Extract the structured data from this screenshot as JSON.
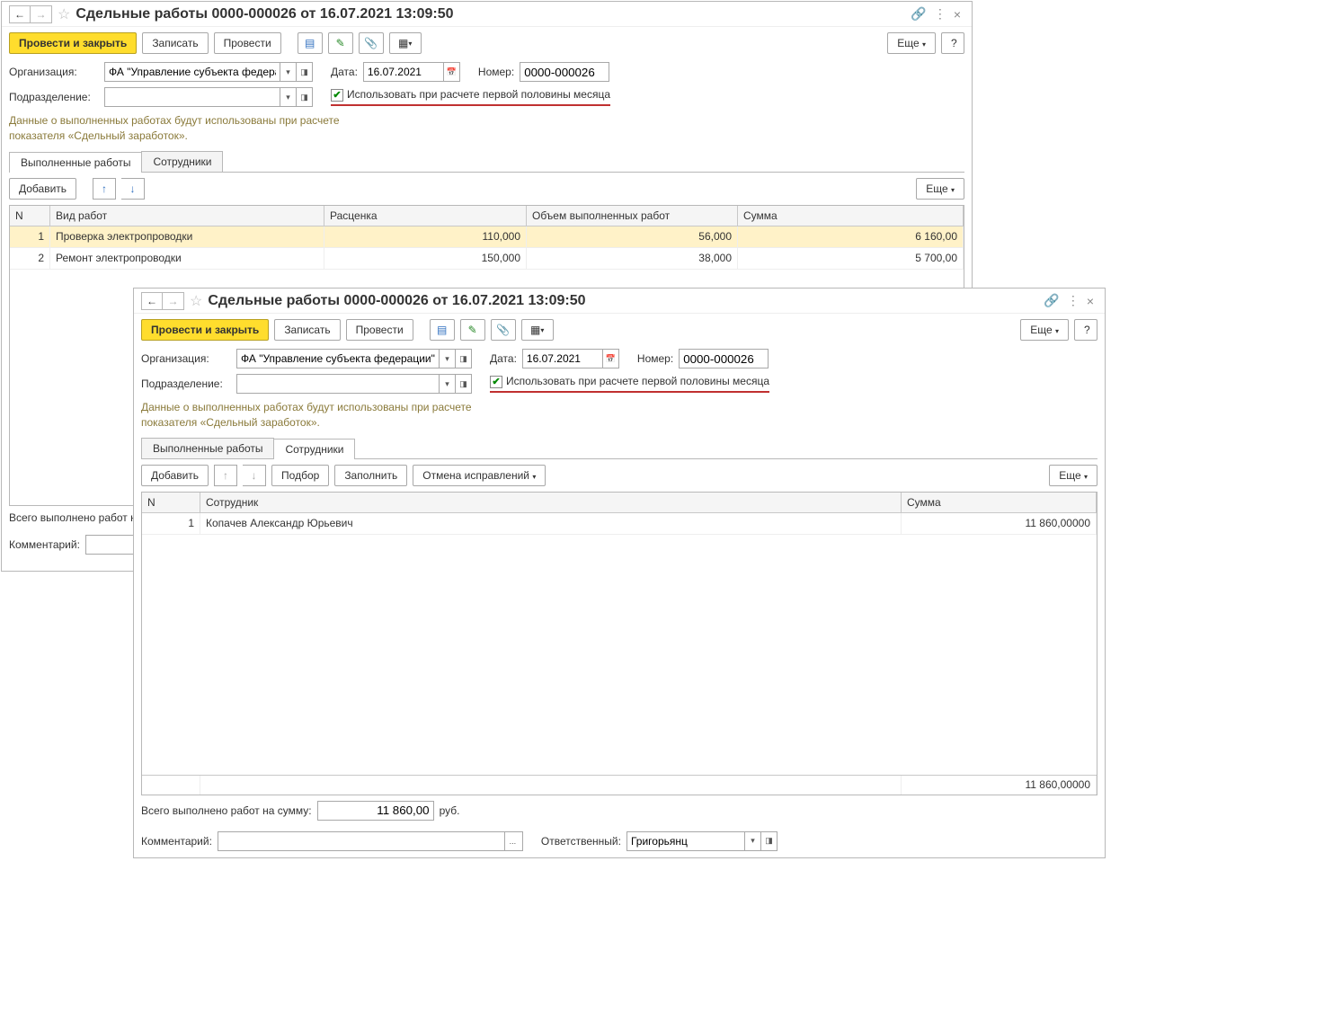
{
  "win1": {
    "title": "Сдельные работы 0000-000026 от 16.07.2021 13:09:50",
    "toolbar": {
      "main": "Провести и закрыть",
      "write": "Записать",
      "post": "Провести",
      "more": "Еще"
    },
    "labels": {
      "org": "Организация:",
      "dept": "Подразделение:",
      "date": "Дата:",
      "num": "Номер:"
    },
    "org": "ФА \"Управление субъекта федерации\"",
    "date": "16.07.2021",
    "num": "0000-000026",
    "checkbox": "Использовать при расчете первой половины месяца",
    "hint1": "Данные о выполненных работах будут использованы при расчете",
    "hint2": "показателя «Сдельный заработок».",
    "tab1": "Выполненные работы",
    "tab2": "Сотрудники",
    "add": "Добавить",
    "more2": "Еще",
    "cols": {
      "n": "N",
      "type": "Вид работ",
      "rate": "Расценка",
      "vol": "Объем выполненных работ",
      "sum": "Сумма"
    },
    "rows": [
      {
        "n": "1",
        "type": "Проверка электропроводки",
        "rate": "110,000",
        "vol": "56,000",
        "sum": "6 160,00"
      },
      {
        "n": "2",
        "type": "Ремонт электропроводки",
        "rate": "150,000",
        "vol": "38,000",
        "sum": "5 700,00"
      }
    ],
    "total_lbl": "Всего выполнено работ на с",
    "comment_lbl": "Комментарий:"
  },
  "win2": {
    "title": "Сдельные работы 0000-000026 от 16.07.2021 13:09:50",
    "toolbar": {
      "main": "Провести и закрыть",
      "write": "Записать",
      "post": "Провести",
      "more": "Еще"
    },
    "labels": {
      "org": "Организация:",
      "dept": "Подразделение:",
      "date": "Дата:",
      "num": "Номер:",
      "resp": "Ответственный:"
    },
    "org": "ФА \"Управление субъекта федерации\"",
    "date": "16.07.2021",
    "num": "0000-000026",
    "checkbox": "Использовать при расчете первой половины месяца",
    "hint1": "Данные о выполненных работах будут использованы при расчете",
    "hint2": "показателя «Сдельный заработок».",
    "tab1": "Выполненные работы",
    "tab2": "Сотрудники",
    "add": "Добавить",
    "pick": "Подбор",
    "fill": "Заполнить",
    "cancel": "Отмена исправлений",
    "more2": "Еще",
    "cols": {
      "n": "N",
      "emp": "Сотрудник",
      "sum": "Сумма"
    },
    "rows": [
      {
        "n": "1",
        "emp": "Копачев Александр Юрьевич",
        "sum": "11 860,00000"
      }
    ],
    "grid_total": "11 860,00000",
    "total_lbl": "Всего выполнено работ на сумму:",
    "total_val": "11 860,00",
    "total_cur": "руб.",
    "comment_lbl": "Комментарий:",
    "resp": "Григорьянц"
  },
  "sym": {
    "help": "?",
    "back": "←",
    "fwd": "→",
    "star": "☆",
    "link": "🔗",
    "kebab": "⋮",
    "close": "×",
    "dd": "▾",
    "open": "◨",
    "cal": "📅",
    "chk": "✔",
    "up": "↑",
    "down": "↓",
    "report": "▤",
    "pen": "✎",
    "clip": "📎",
    "tpl": "▦",
    "dots": "..."
  }
}
